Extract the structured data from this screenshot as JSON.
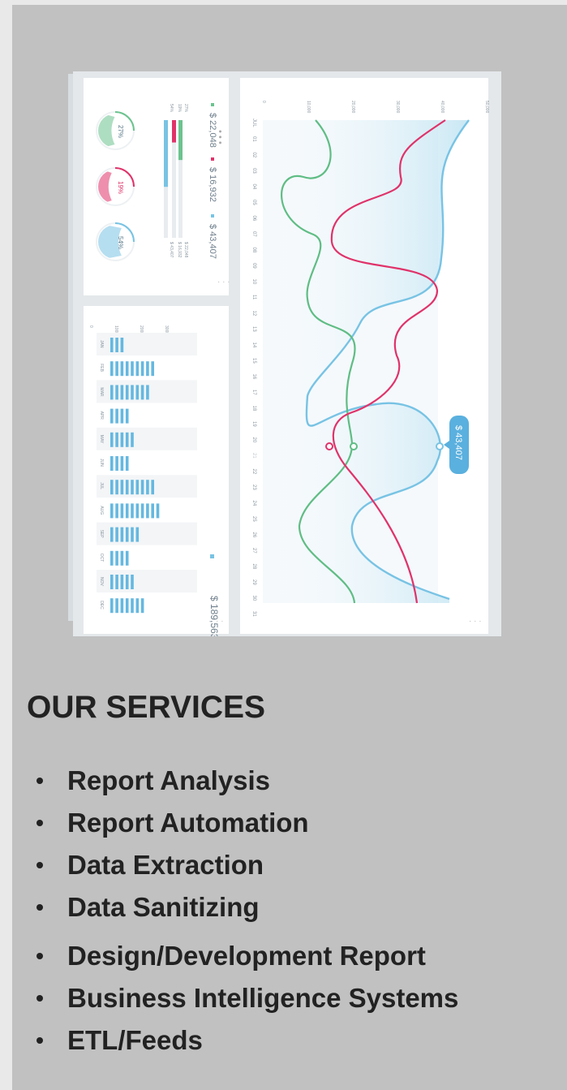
{
  "dashboard": {
    "totals": {
      "green": "$ 22,048",
      "pink": "$ 16,932",
      "blue": "$ 43,407",
      "year_total": "$ 189,563"
    },
    "donuts": [
      {
        "label": "27%",
        "value": 27,
        "color": "#6cc38f"
      },
      {
        "label": "19%",
        "value": 19,
        "color": "#e0336a"
      },
      {
        "label": "54%",
        "value": 54,
        "color": "#78c3e4"
      }
    ],
    "mini_bars": [
      {
        "pct": "27%",
        "amount": "$ 22,048",
        "fill": 0.27,
        "color": "#6cc38f"
      },
      {
        "pct": "19%",
        "amount": "$ 16,932",
        "fill": 0.19,
        "color": "#e0336a"
      },
      {
        "pct": "54%",
        "amount": "$ 43,407",
        "fill": 0.54,
        "color": "#78c3e4"
      }
    ],
    "monthly": {
      "axis_ticks": [
        "0",
        "100k",
        "200k",
        "300k"
      ],
      "months": [
        "JAN",
        "FEB",
        "MAR",
        "APR",
        "MAY",
        "JUN",
        "JUL",
        "AUG",
        "SEP",
        "OCT",
        "NOV",
        "DEC"
      ],
      "bar_counts": [
        3,
        9,
        8,
        4,
        5,
        4,
        9,
        10,
        6,
        4,
        5,
        7
      ]
    },
    "main_chart": {
      "value_ticks": [
        "0",
        "10,000",
        "20,000",
        "30,000",
        "40,000",
        "50,000"
      ],
      "month_label": "JUL",
      "days": [
        "01",
        "02",
        "03",
        "04",
        "05",
        "06",
        "07",
        "08",
        "09",
        "10",
        "11",
        "12",
        "13",
        "14",
        "15",
        "16",
        "17",
        "18",
        "19",
        "20",
        "21",
        "22",
        "23",
        "24",
        "25",
        "26",
        "27",
        "28",
        "29",
        "30",
        "31"
      ],
      "tooltip": "$ 43,407",
      "colors": {
        "green": "#5fbd84",
        "pink": "#e0336a",
        "blue": "#78c3e4"
      }
    }
  },
  "services": {
    "heading": "OUR SERVICES",
    "items": [
      "Report Analysis",
      "Report Automation",
      "Data Extraction",
      "Data Sanitizing",
      "Design/Development Report",
      "Business Intelligence Systems",
      "ETL/Feeds"
    ]
  }
}
